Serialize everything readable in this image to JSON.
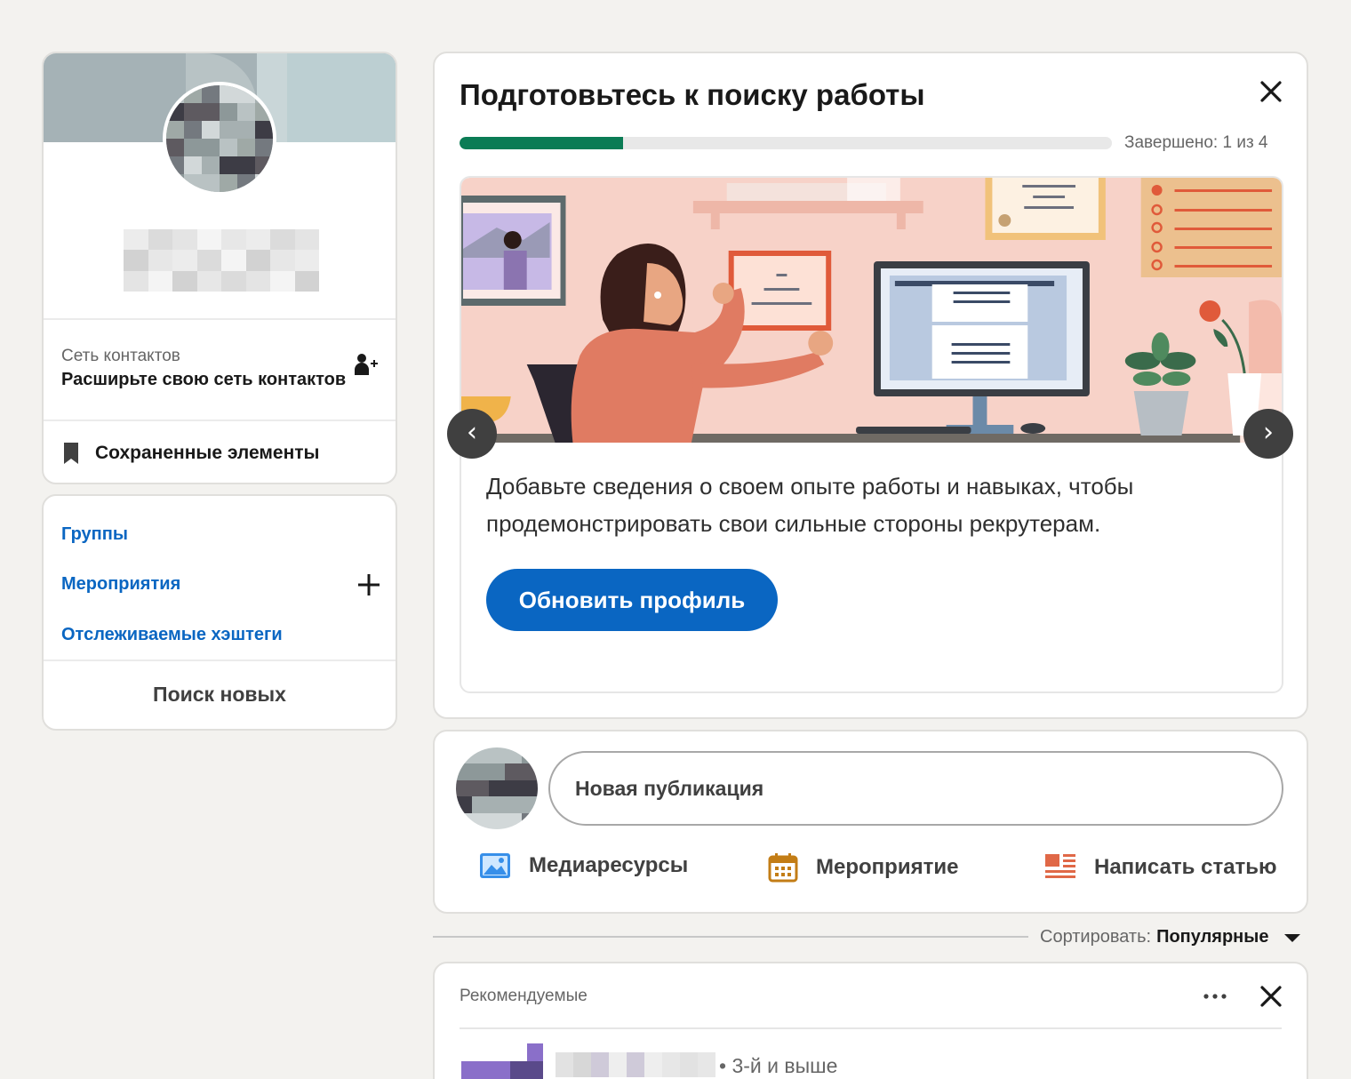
{
  "profile": {
    "contacts_title": "Сеть контактов",
    "contacts_cta": "Расширьте свою сеть контактов",
    "saved_items": "Сохраненные элементы"
  },
  "links": {
    "groups": "Группы",
    "events": "Мероприятия",
    "hashtags": "Отслеживаемые хэштеги",
    "discover": "Поиск новых"
  },
  "job_card": {
    "title": "Подготовьтесь к поиску работы",
    "progress_text": "Завершено: 1 из 4",
    "progress_fraction": 0.25,
    "description": "Добавьте сведения о своем опыте работы и навыках, чтобы продемонстрировать свои сильные стороны рекрутерам.",
    "button": "Обновить профиль",
    "prev_arrow": "‹",
    "next_arrow": "›"
  },
  "composer": {
    "placeholder": "Новая публикация",
    "media": "Медиаресурсы",
    "event": "Мероприятие",
    "article": "Написать статью"
  },
  "sort": {
    "label": "Сортировать:",
    "value": "Популярные"
  },
  "recommended": {
    "label": "Рекомендуемые",
    "degree": "• 3-й и выше"
  },
  "colors": {
    "accent": "#0a66c2",
    "progress": "#0b7c55",
    "background": "#f3f2ef"
  }
}
